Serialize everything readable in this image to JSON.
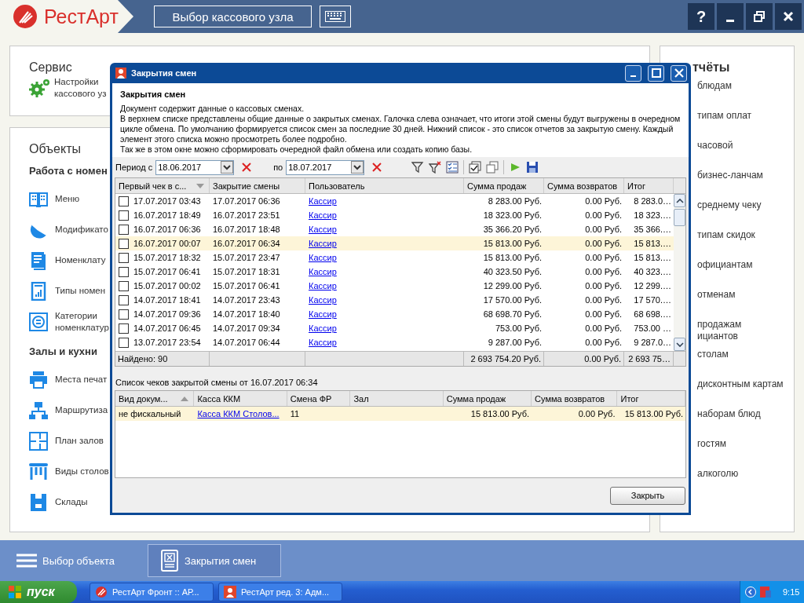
{
  "header": {
    "logo": "РестАрт",
    "node_button": "Выбор кассового узла",
    "help_button": "?"
  },
  "service": {
    "title": "Сервис",
    "items": [
      {
        "lines": [
          "Настройки",
          "кассового уз"
        ]
      }
    ]
  },
  "objects": {
    "title": "Объекты",
    "sections": [
      {
        "title": "Работа с номен",
        "items": [
          {
            "lines": [
              "Меню"
            ]
          },
          {
            "lines": [
              "Модификато"
            ]
          },
          {
            "lines": [
              "Номенклату"
            ]
          },
          {
            "lines": [
              "Типы номен"
            ]
          },
          {
            "lines": [
              "Категории",
              "номенклатур"
            ]
          }
        ]
      },
      {
        "title": "Залы и кухни",
        "items": [
          {
            "lines": [
              "Места печат"
            ]
          },
          {
            "lines": [
              "Маршрутиза"
            ]
          },
          {
            "lines": [
              "План залов"
            ]
          },
          {
            "lines": [
              "Виды столов"
            ]
          },
          {
            "lines": [
              "Склады"
            ]
          }
        ]
      }
    ]
  },
  "reports": {
    "title": "тчёты",
    "items": [
      {
        "lines": [
          "блюдам"
        ]
      },
      {
        "lines": [
          "типам оплат"
        ]
      },
      {
        "lines": [
          "часовой"
        ]
      },
      {
        "lines": [
          "бизнес-ланчам"
        ]
      },
      {
        "lines": [
          "среднему чеку"
        ]
      },
      {
        "lines": [
          "типам скидок"
        ]
      },
      {
        "lines": [
          "официантам"
        ]
      },
      {
        "lines": [
          "отменам"
        ]
      },
      {
        "lines": [
          "продажам",
          "ициантов"
        ]
      },
      {
        "lines": [
          "столам"
        ]
      },
      {
        "lines": [
          "дисконтным картам"
        ]
      },
      {
        "lines": [
          "наборам блюд"
        ]
      },
      {
        "lines": [
          "гостям"
        ]
      },
      {
        "lines": [
          "алкоголю"
        ]
      }
    ]
  },
  "dialog": {
    "title": "Закрытия смен",
    "heading": "Закрытия смен",
    "description": [
      "Документ содержит данные о кассовых сменах.",
      "В верхнем списке представлены общие данные о закрытых сменах. Галочка слева означает, что итоги этой смены будут выгружены в очередном цикле обмена. По умолчанию формируется список смен за последние 30 дней. Нижний список - это список отчетов за закрытую смену. Каждый элемент этого списка можно просмотреть более подробно.",
      "Так же в этом окне можно сформировать очередной файл обмена или создать копию базы."
    ],
    "period": {
      "from_label": "Период с",
      "from": "18.06.2017",
      "to_label": "по",
      "to": "18.07.2017"
    },
    "shifts": {
      "columns": [
        {
          "label": "Первый чек в с...",
          "kind": "date",
          "sorted": true,
          "ascending": false
        },
        {
          "label": "Закрытие смены",
          "kind": "date",
          "sorted": false
        },
        {
          "label": "Пользователь",
          "kind": "link",
          "sorted": false
        },
        {
          "label": "Сумма продаж",
          "kind": "money",
          "sorted": false
        },
        {
          "label": "Сумма возвратов",
          "kind": "money",
          "sorted": false
        },
        {
          "label": "Итог",
          "kind": "money",
          "sorted": false
        }
      ],
      "rows": [
        {
          "checked": false,
          "selected": false,
          "cells": [
            "17.07.2017 03:43",
            "17.07.2017 06:36",
            "Кассир",
            "8 283.00 Руб.",
            "0.00 Руб.",
            "8 283.0…"
          ]
        },
        {
          "checked": false,
          "selected": false,
          "cells": [
            "16.07.2017 18:49",
            "16.07.2017 23:51",
            "Кассир",
            "18 323.00 Руб.",
            "0.00 Руб.",
            "18 323.…"
          ]
        },
        {
          "checked": false,
          "selected": false,
          "cells": [
            "16.07.2017 06:36",
            "16.07.2017 18:48",
            "Кассир",
            "35 366.20 Руб.",
            "0.00 Руб.",
            "35 366.…"
          ]
        },
        {
          "checked": false,
          "selected": true,
          "cells": [
            "16.07.2017 00:07",
            "16.07.2017 06:34",
            "Кассир",
            "15 813.00 Руб.",
            "0.00 Руб.",
            "15 813.…"
          ]
        },
        {
          "checked": false,
          "selected": false,
          "cells": [
            "15.07.2017 18:32",
            "15.07.2017 23:47",
            "Кассир",
            "15 813.00 Руб.",
            "0.00 Руб.",
            "15 813.…"
          ]
        },
        {
          "checked": false,
          "selected": false,
          "cells": [
            "15.07.2017 06:41",
            "15.07.2017 18:31",
            "Кассир",
            "40 323.50 Руб.",
            "0.00 Руб.",
            "40 323.…"
          ]
        },
        {
          "checked": false,
          "selected": false,
          "cells": [
            "15.07.2017 00:02",
            "15.07.2017 06:41",
            "Кассир",
            "12 299.00 Руб.",
            "0.00 Руб.",
            "12 299.…"
          ]
        },
        {
          "checked": false,
          "selected": false,
          "cells": [
            "14.07.2017 18:41",
            "14.07.2017 23:43",
            "Кассир",
            "17 570.00 Руб.",
            "0.00 Руб.",
            "17 570.…"
          ]
        },
        {
          "checked": false,
          "selected": false,
          "cells": [
            "14.07.2017 09:36",
            "14.07.2017 18:40",
            "Кассир",
            "68 698.70 Руб.",
            "0.00 Руб.",
            "68 698.…"
          ]
        },
        {
          "checked": false,
          "selected": false,
          "cells": [
            "14.07.2017 06:45",
            "14.07.2017 09:34",
            "Кассир",
            "753.00 Руб.",
            "0.00 Руб.",
            "753.00 …"
          ]
        },
        {
          "checked": false,
          "selected": false,
          "cells": [
            "13.07.2017 23:54",
            "14.07.2017 06:44",
            "Кассир",
            "9 287.00 Руб.",
            "0.00 Руб.",
            "9 287.0…"
          ]
        }
      ],
      "footer": {
        "found": "Найдено: 90",
        "totals": [
          "2 693 754.20 Руб.",
          "0.00 Руб.",
          "2 693 75…"
        ]
      }
    },
    "details_label": "Список чеков закрытой смены от 16.07.2017 06:34",
    "details": {
      "columns": [
        {
          "label": "Вид докум...",
          "kind": "text",
          "sorted": true,
          "ascending": true
        },
        {
          "label": "Касса ККМ",
          "kind": "link",
          "sorted": false
        },
        {
          "label": "Смена ФР",
          "kind": "text",
          "sorted": false
        },
        {
          "label": "Зал",
          "kind": "text",
          "sorted": false
        },
        {
          "label": "Сумма продаж",
          "kind": "money",
          "sorted": false
        },
        {
          "label": "Сумма возвратов",
          "kind": "money",
          "sorted": false
        },
        {
          "label": "Итог",
          "kind": "money",
          "sorted": false
        }
      ],
      "rows": [
        {
          "selected": true,
          "cells": [
            "не фискальный",
            "Касса ККМ Столов...",
            "11",
            null,
            "15 813.00 Руб.",
            "0.00 Руб.",
            "15 813.00 Руб."
          ]
        }
      ]
    },
    "close_button": "Закрыть"
  },
  "bottom_bar": {
    "menu_label": "Выбор объекта",
    "tabs": [
      {
        "label": "Закрытия смен",
        "selected": true
      }
    ]
  },
  "taskbar": {
    "start": "пуск",
    "tasks": [
      {
        "label": "РестАрт Фронт :: АР...",
        "kind": "front",
        "selected": false
      },
      {
        "label": "РестАрт ред. 3: Адм...",
        "kind": "admin",
        "selected": false
      }
    ],
    "clock": "9:15"
  }
}
